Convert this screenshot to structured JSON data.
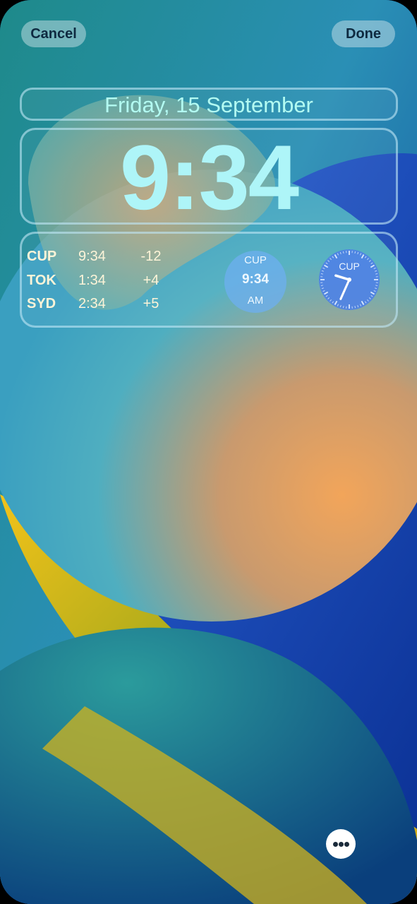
{
  "header": {
    "cancel_label": "Cancel",
    "done_label": "Done"
  },
  "lock_screen": {
    "date": "Friday, 15 September",
    "time": "9:34"
  },
  "world_clock_widget": {
    "rows": [
      {
        "city": "CUP",
        "time": "9:34",
        "offset": "-12"
      },
      {
        "city": "TOK",
        "time": "1:34",
        "offset": "+4"
      },
      {
        "city": "SYD",
        "time": "2:34",
        "offset": "+5"
      }
    ]
  },
  "digital_clock_widget": {
    "city": "CUP",
    "time": "9:34",
    "period": "AM"
  },
  "analog_clock_widget": {
    "city": "CUP",
    "hour": 9,
    "minute": 34
  },
  "icons": {
    "more": "ellipsis-icon"
  },
  "colors": {
    "accent_text": "#b3fbf2",
    "clock_text": "#aef5f8",
    "widget_text": "#fdf4d8",
    "analog_face": "#4f82e6"
  }
}
